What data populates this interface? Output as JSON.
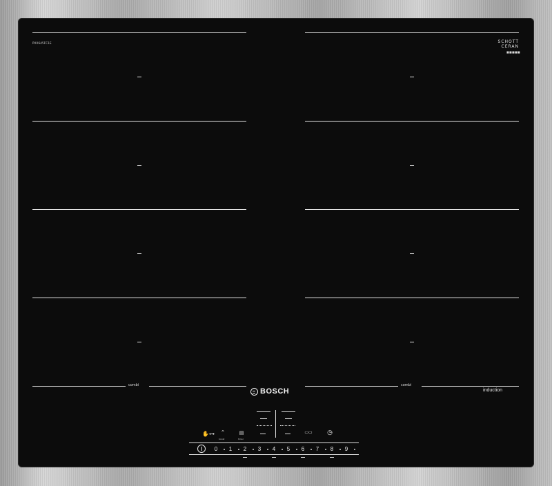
{
  "appliance": {
    "brand": "BOSCH",
    "type_label": "induction",
    "glass_maker": [
      "SCHOTT",
      "CERAN"
    ],
    "model_small_left": "PXX645FC1E",
    "model_small_right": "SCHOTT CERAN",
    "zones": {
      "left": [
        "–",
        "–",
        "–",
        "–"
      ],
      "right": [
        "–",
        "–",
        "–",
        "–"
      ]
    },
    "combi_left": "combi",
    "combi_right": "combi"
  },
  "controls": {
    "power_symbol": "I",
    "lock_label": "lock",
    "boost_label": "boost",
    "timer_label": "timer",
    "flex_label": "flex",
    "clock_label": "clock",
    "scale": [
      "0",
      "1",
      "2",
      "3",
      "4",
      "5",
      "6",
      "7",
      "8",
      "9"
    ],
    "displays": [
      "–",
      "–",
      "–",
      "–"
    ]
  },
  "colors": {
    "glass": "#0c0c0c",
    "frame": "#b5b5b5",
    "print": "#e8e8e8"
  }
}
